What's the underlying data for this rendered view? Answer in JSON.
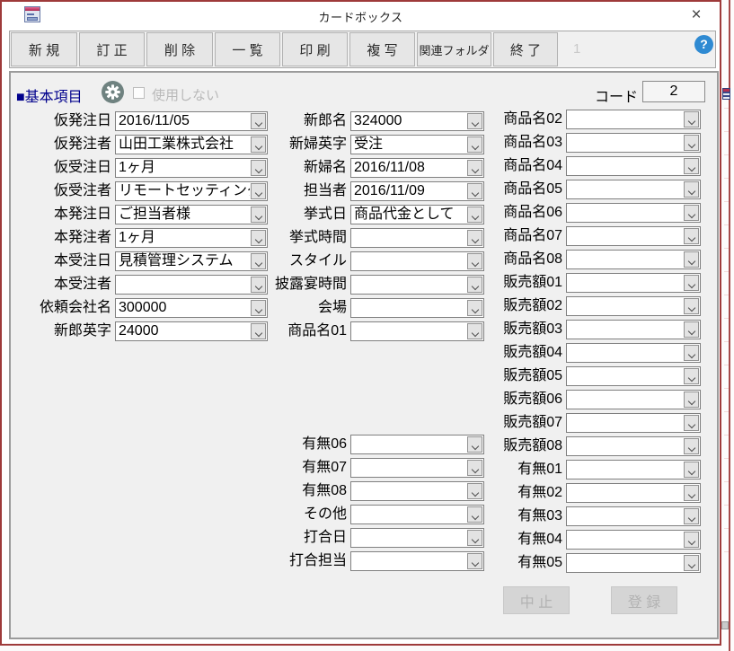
{
  "window": {
    "title": "カードボックス",
    "close_glyph": "×"
  },
  "toolbar": {
    "buttons": [
      "新 規",
      "訂 正",
      "削 除",
      "一 覧",
      "印 刷",
      "複 写",
      "関連フォルダ",
      "終 了"
    ],
    "record_counter": "1",
    "help_glyph": "?"
  },
  "section": {
    "title": "■基本項目",
    "checkbox_label": "使用しない",
    "checkbox_checked": false,
    "code_label": "コード",
    "code_value": "2"
  },
  "fields": {
    "left": [
      {
        "label": "仮発注日",
        "value": "2016/11/05"
      },
      {
        "label": "仮発注者",
        "value": "山田工業株式会社"
      },
      {
        "label": "仮受注日",
        "value": "1ヶ月"
      },
      {
        "label": "仮受注者",
        "value": "リモートセッティング"
      },
      {
        "label": "本発注日",
        "value": "ご担当者様"
      },
      {
        "label": "本発注者",
        "value": "1ヶ月"
      },
      {
        "label": "本受注日",
        "value": "見積管理システム"
      },
      {
        "label": "本受注者",
        "value": ""
      },
      {
        "label": "依頼会社名",
        "value": "300000"
      },
      {
        "label": "新郎英字",
        "value": "24000"
      }
    ],
    "middle": [
      {
        "label": "新郎名",
        "value": "324000"
      },
      {
        "label": "新婦英字",
        "value": "受注"
      },
      {
        "label": "新婦名",
        "value": "2016/11/08"
      },
      {
        "label": "担当者",
        "value": "2016/11/09"
      },
      {
        "label": "挙式日",
        "value": "商品代金として"
      },
      {
        "label": "挙式時間",
        "value": ""
      },
      {
        "label": "スタイル",
        "value": ""
      },
      {
        "label": "披露宴時間",
        "value": ""
      },
      {
        "label": "会場",
        "value": ""
      },
      {
        "label": "商品名01",
        "value": ""
      }
    ],
    "middle_lower": [
      {
        "label": "有無06",
        "value": ""
      },
      {
        "label": "有無07",
        "value": ""
      },
      {
        "label": "有無08",
        "value": ""
      },
      {
        "label": "その他",
        "value": ""
      },
      {
        "label": "打合日",
        "value": ""
      },
      {
        "label": "打合担当",
        "value": ""
      }
    ],
    "right": [
      {
        "label": "商品名02",
        "value": ""
      },
      {
        "label": "商品名03",
        "value": ""
      },
      {
        "label": "商品名04",
        "value": ""
      },
      {
        "label": "商品名05",
        "value": ""
      },
      {
        "label": "商品名06",
        "value": ""
      },
      {
        "label": "商品名07",
        "value": ""
      },
      {
        "label": "商品名08",
        "value": ""
      },
      {
        "label": "販売額01",
        "value": ""
      },
      {
        "label": "販売額02",
        "value": ""
      },
      {
        "label": "販売額03",
        "value": ""
      },
      {
        "label": "販売額04",
        "value": ""
      },
      {
        "label": "販売額05",
        "value": ""
      },
      {
        "label": "販売額06",
        "value": ""
      },
      {
        "label": "販売額07",
        "value": ""
      },
      {
        "label": "販売額08",
        "value": ""
      },
      {
        "label": "有無01",
        "value": ""
      },
      {
        "label": "有無02",
        "value": ""
      },
      {
        "label": "有無03",
        "value": ""
      },
      {
        "label": "有無04",
        "value": ""
      },
      {
        "label": "有無05",
        "value": ""
      }
    ]
  },
  "footer": {
    "cancel_label": "中 止",
    "register_label": "登 録"
  },
  "colors": {
    "window_border": "#9e3a3a",
    "panel_bg": "#f0f0f0",
    "section_title": "#00008c",
    "help_blue": "#2f8ad2",
    "gear_circle": "#6f8280",
    "disabled_text": "#b2b2b2"
  }
}
